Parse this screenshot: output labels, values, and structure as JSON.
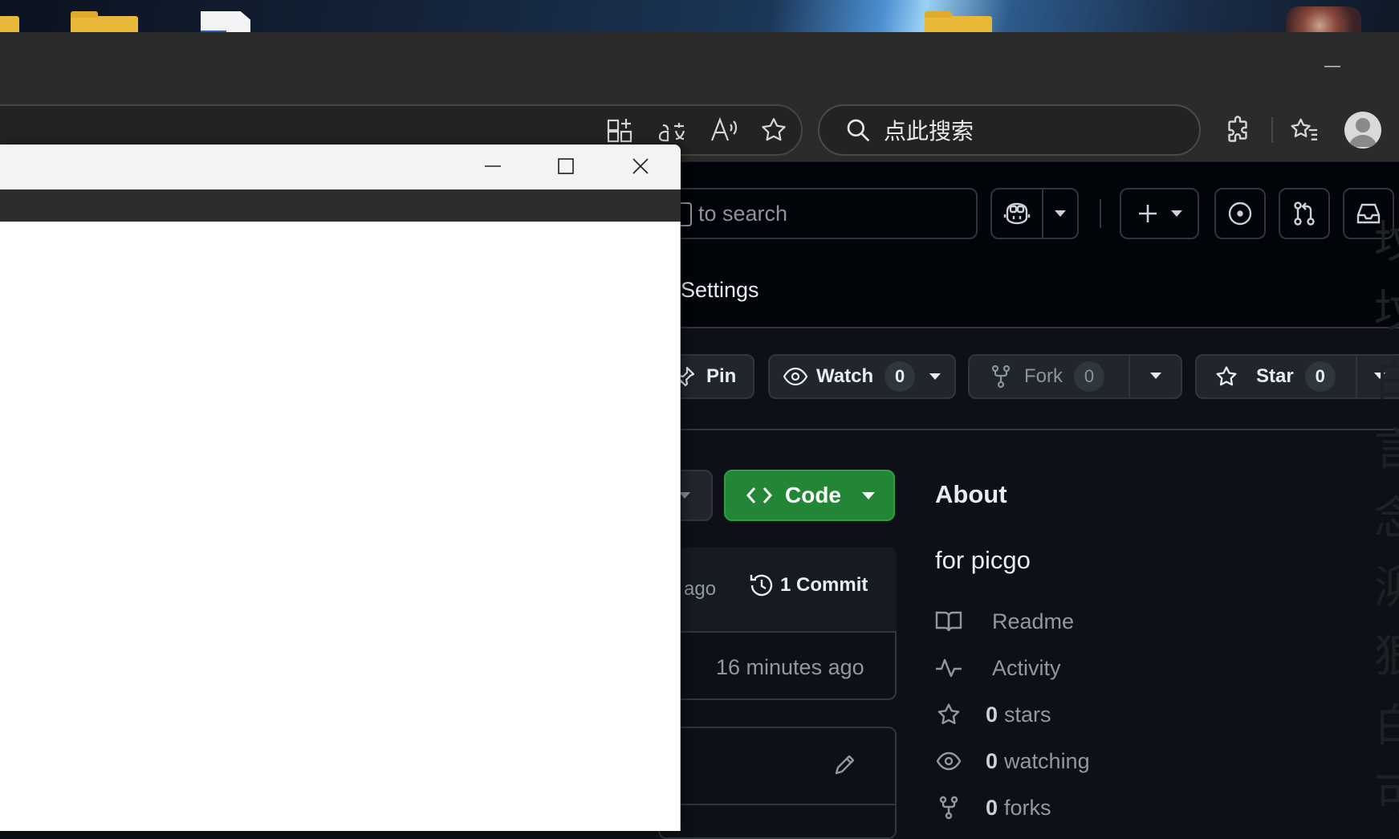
{
  "browser": {
    "search_text": "点此搜索",
    "minimize_glyph": "—"
  },
  "github": {
    "search_text": "to search",
    "settings_tab": "Settings",
    "pin_label": "Pin",
    "watch_label": "Watch",
    "watch_count": "0",
    "fork_label": "Fork",
    "fork_count": "0",
    "star_label": "Star",
    "star_count": "0",
    "code_label": "Code",
    "commit_ago": "ago",
    "commit_count": "1 Commit",
    "file_time": "16 minutes ago",
    "about": {
      "title": "About",
      "description": "for picgo",
      "items": [
        {
          "bold": "",
          "text": "Readme",
          "icon": "book-icon"
        },
        {
          "bold": "",
          "text": "Activity",
          "icon": "pulse-icon"
        },
        {
          "bold": "0",
          "text": "stars",
          "icon": "star-icon"
        },
        {
          "bold": "0",
          "text": "watching",
          "icon": "eye-icon"
        },
        {
          "bold": "0",
          "text": "forks",
          "icon": "fork-icon"
        }
      ]
    }
  },
  "wallpaper": {
    "calligraphy": "坟坟白言念泖狠白可爱"
  },
  "colors": {
    "github_bg": "#0d1117",
    "code_button": "#238636",
    "browser_chrome": "#2b2b2b"
  }
}
